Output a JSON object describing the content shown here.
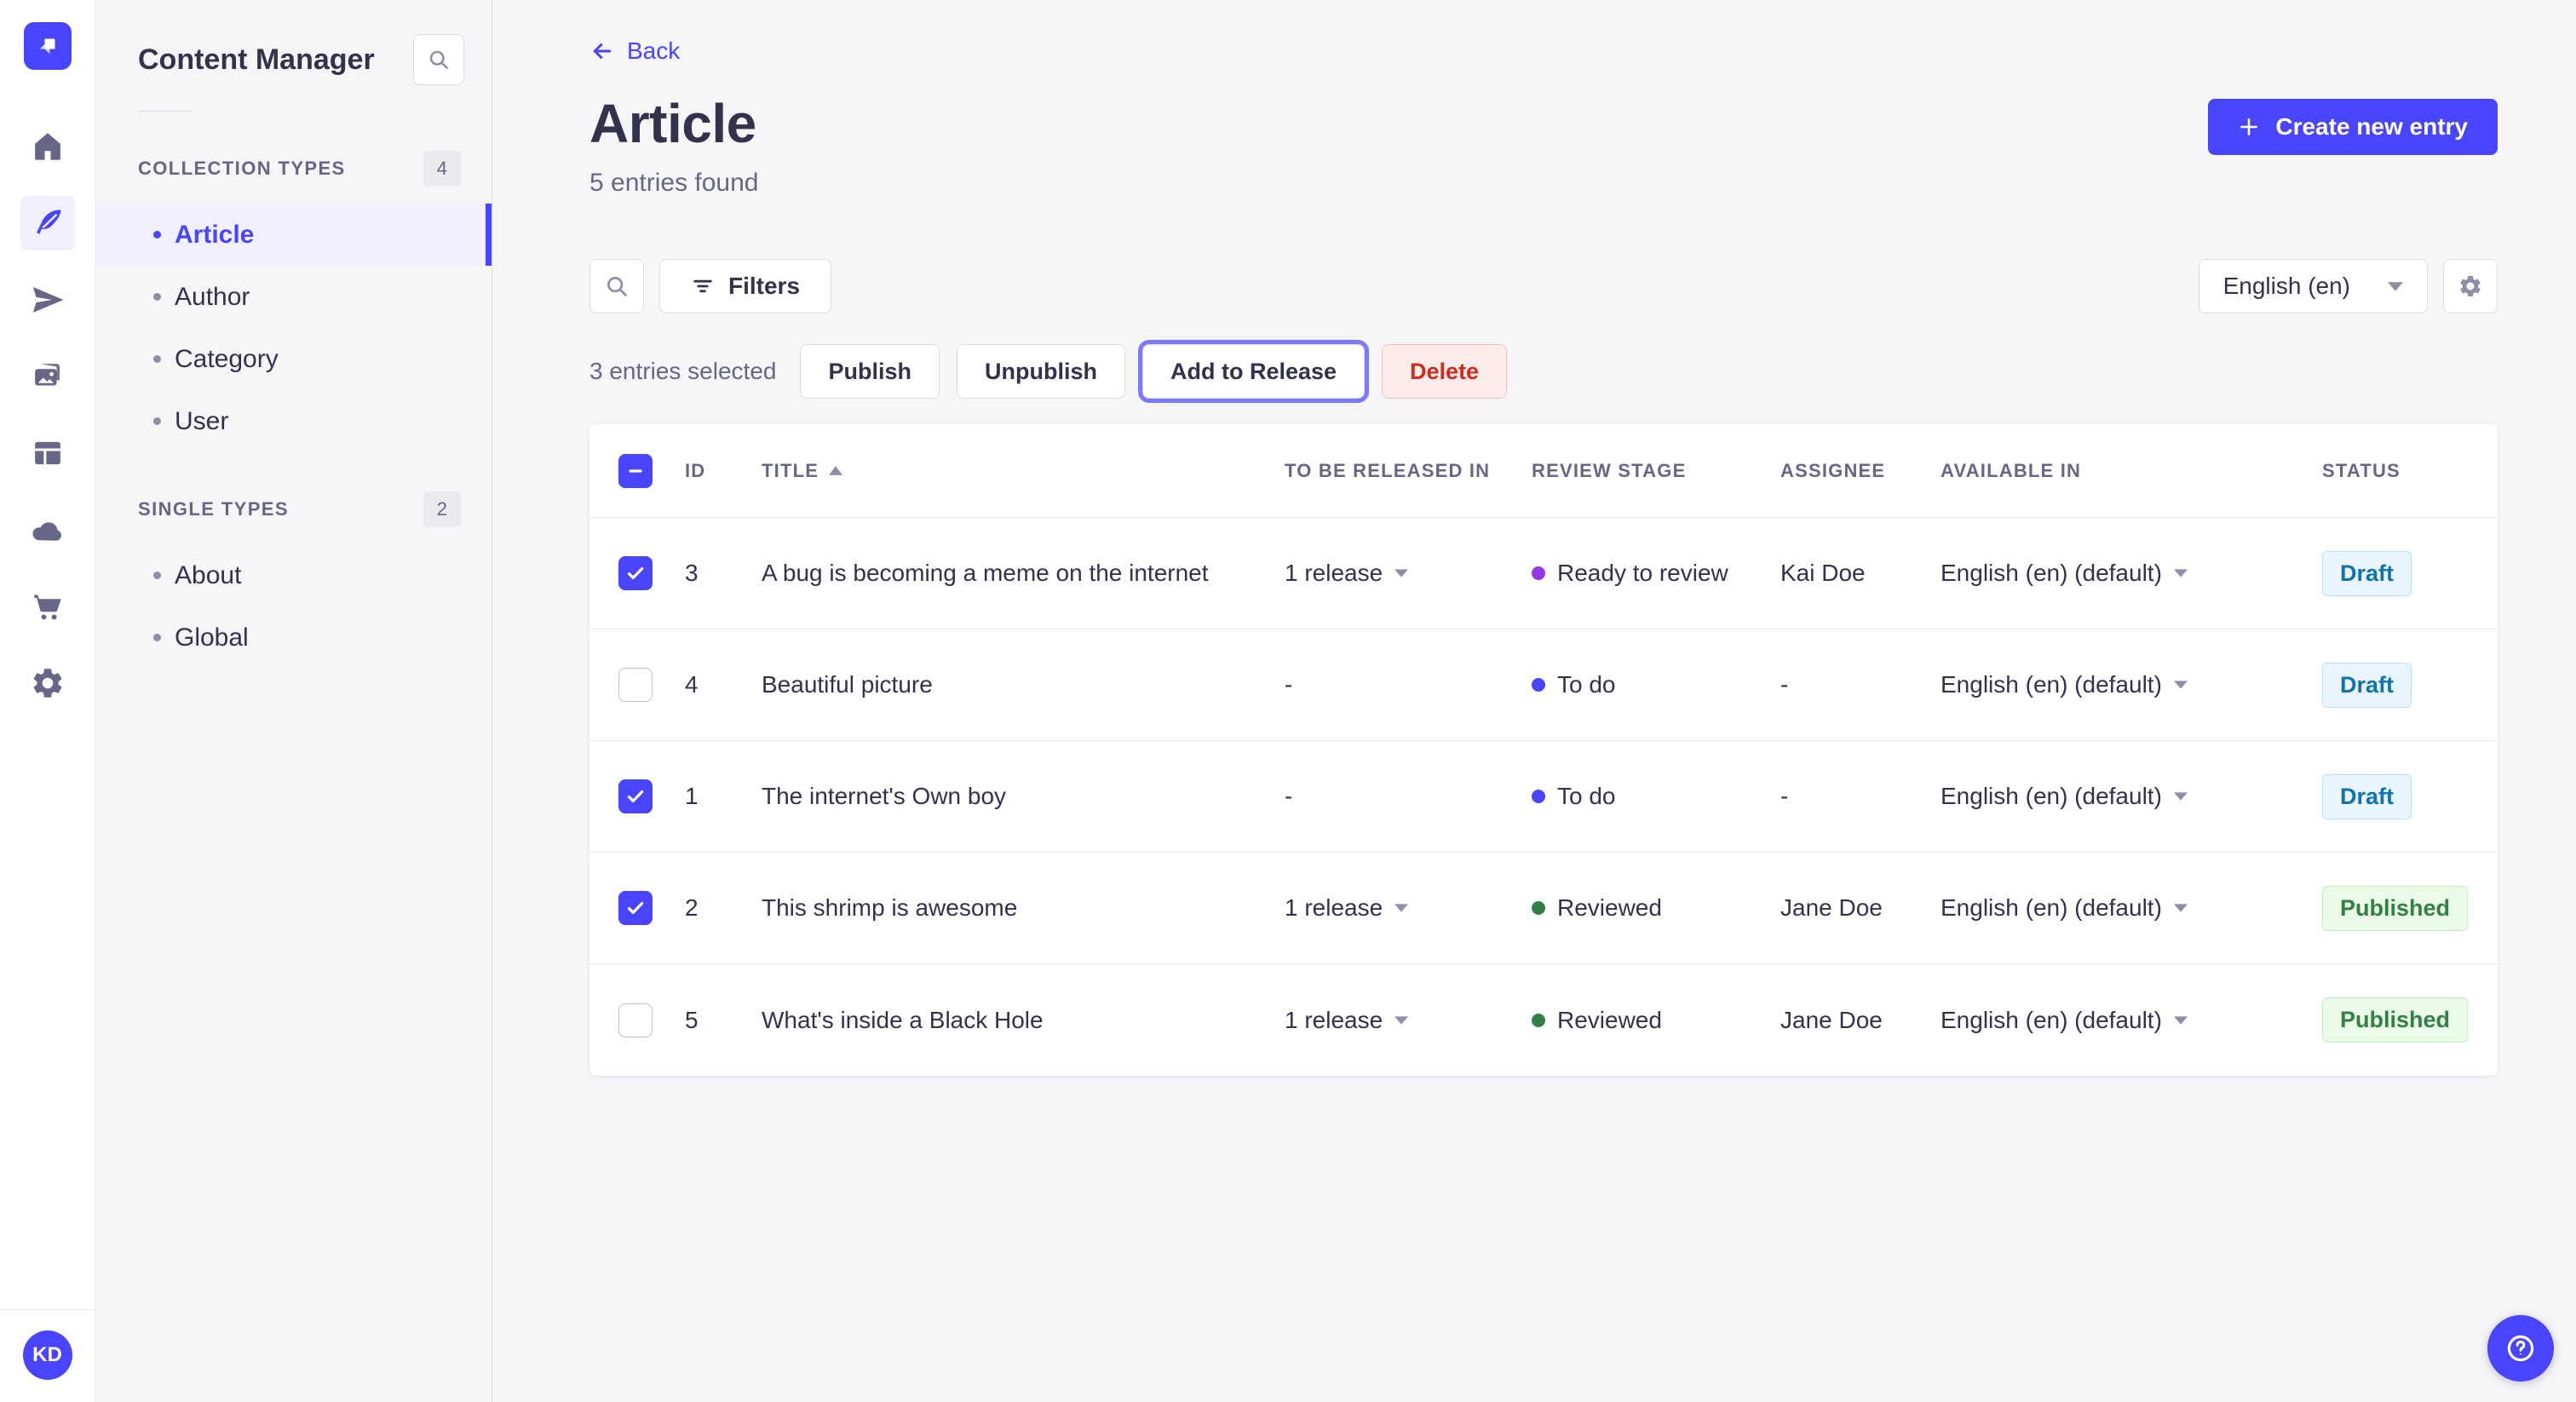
{
  "nav": {
    "items": [
      {
        "name": "home-icon",
        "active": false
      },
      {
        "name": "content-manager-icon",
        "active": true
      },
      {
        "name": "releases-icon",
        "active": false
      },
      {
        "name": "media-library-icon",
        "active": false
      },
      {
        "name": "content-type-builder-icon",
        "active": false
      },
      {
        "name": "deploy-cloud-icon",
        "active": false
      },
      {
        "name": "marketplace-icon",
        "active": false
      },
      {
        "name": "settings-icon",
        "active": false
      }
    ],
    "avatar_initials": "KD"
  },
  "sidebar": {
    "title": "Content Manager",
    "sections": [
      {
        "label": "COLLECTION TYPES",
        "count": "4",
        "items": [
          {
            "label": "Article",
            "active": true
          },
          {
            "label": "Author",
            "active": false
          },
          {
            "label": "Category",
            "active": false
          },
          {
            "label": "User",
            "active": false
          }
        ]
      },
      {
        "label": "SINGLE TYPES",
        "count": "2",
        "items": [
          {
            "label": "About",
            "active": false
          },
          {
            "label": "Global",
            "active": false
          }
        ]
      }
    ]
  },
  "header": {
    "back_label": "Back",
    "title": "Article",
    "subtitle": "5 entries found",
    "create_button_label": "Create new entry"
  },
  "toolbar": {
    "filters_label": "Filters",
    "locale_value": "English (en)"
  },
  "selection": {
    "text": "3 entries selected",
    "publish_label": "Publish",
    "unpublish_label": "Unpublish",
    "add_to_release_label": "Add to Release",
    "delete_label": "Delete"
  },
  "table": {
    "header_checkbox": "indeterminate",
    "columns": [
      {
        "label": "ID",
        "sorted": null
      },
      {
        "label": "TITLE",
        "sorted": "asc"
      },
      {
        "label": "TO BE RELEASED IN",
        "sorted": null
      },
      {
        "label": "REVIEW STAGE",
        "sorted": null
      },
      {
        "label": "ASSIGNEE",
        "sorted": null
      },
      {
        "label": "AVAILABLE IN",
        "sorted": null
      },
      {
        "label": "STATUS",
        "sorted": null
      }
    ],
    "rows": [
      {
        "checked": true,
        "id": "3",
        "title": "A bug is becoming a meme on the internet",
        "release": "1 release",
        "stage": "Ready to review",
        "stage_color": "#9736e8",
        "assignee": "Kai Doe",
        "available": "English (en) (default)",
        "status": "Draft"
      },
      {
        "checked": false,
        "id": "4",
        "title": "Beautiful picture",
        "release": "-",
        "stage": "To do",
        "stage_color": "#4945ff",
        "assignee": "-",
        "available": "English (en) (default)",
        "status": "Draft"
      },
      {
        "checked": true,
        "id": "1",
        "title": "The internet's Own boy",
        "release": "-",
        "stage": "To do",
        "stage_color": "#4945ff",
        "assignee": "-",
        "available": "English (en) (default)",
        "status": "Draft"
      },
      {
        "checked": true,
        "id": "2",
        "title": "This shrimp is awesome",
        "release": "1 release",
        "stage": "Reviewed",
        "stage_color": "#328048",
        "assignee": "Jane Doe",
        "available": "English (en) (default)",
        "status": "Published"
      },
      {
        "checked": false,
        "id": "5",
        "title": "What's inside a Black Hole",
        "release": "1 release",
        "stage": "Reviewed",
        "stage_color": "#328048",
        "assignee": "Jane Doe",
        "available": "English (en) (default)",
        "status": "Published"
      }
    ]
  },
  "colors": {
    "primary": "#4945ff",
    "focus_ring": "#7b79ff",
    "draft_text": "#0c75af",
    "published_text": "#328048",
    "delete_text": "#d02b20"
  }
}
